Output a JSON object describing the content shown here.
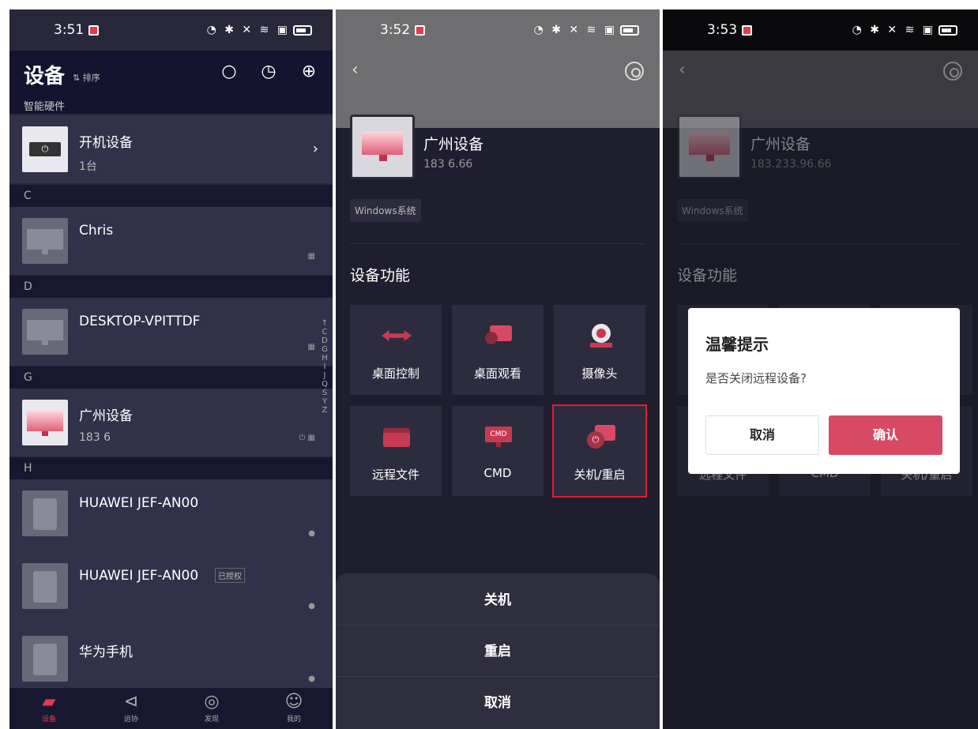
{
  "panel1": {
    "status_time": "3:51",
    "title": "设备",
    "sort_label": "⇅ 排序",
    "section_label": "智能硬件",
    "boot_device": {
      "name": "开机设备",
      "count": "1台"
    },
    "groups": [
      {
        "letter": "C",
        "devices": [
          {
            "name": "Chris",
            "sub": ""
          }
        ]
      },
      {
        "letter": "D",
        "devices": [
          {
            "name": "DESKTOP-VPITTDF",
            "sub": ""
          }
        ]
      },
      {
        "letter": "G",
        "devices": [
          {
            "name": "广州设备",
            "sub": "183 6"
          }
        ]
      },
      {
        "letter": "H",
        "devices": [
          {
            "name": "HUAWEI JEF-AN00",
            "sub": ""
          },
          {
            "name": "HUAWEI JEF-AN00",
            "sub": "",
            "badge": "已授权"
          },
          {
            "name": "华为手机",
            "sub": ""
          }
        ]
      }
    ],
    "alphabet": [
      "↑",
      "C",
      "D",
      "G",
      "H",
      "I",
      "J",
      "Q",
      "S",
      "Y",
      "Z"
    ],
    "tabs": [
      {
        "label": "设备",
        "icon": "devices-icon",
        "active": true
      },
      {
        "label": "远协",
        "icon": "send-icon",
        "active": false
      },
      {
        "label": "发现",
        "icon": "compass-icon",
        "active": false
      },
      {
        "label": "我的",
        "icon": "profile-icon",
        "active": false
      }
    ]
  },
  "panel2": {
    "status_time": "3:52",
    "device_name": "广州设备",
    "device_ip": "183 6.66",
    "os_tag": "Windows系统",
    "section_title": "设备功能",
    "functions": [
      "桌面控制",
      "桌面观看",
      "摄像头",
      "远程文件",
      "CMD",
      "关机/重启"
    ],
    "sheet_options": [
      "关机",
      "重启",
      "取消"
    ]
  },
  "panel3": {
    "status_time": "3:53",
    "device_name": "广州设备",
    "device_ip": "183.233.96.66",
    "os_tag": "Windows系统",
    "section_title": "设备功能",
    "dialog": {
      "title": "温馨提示",
      "message": "是否关闭远程设备?",
      "cancel": "取消",
      "confirm": "确认"
    },
    "bg_labels": [
      "远程文件",
      "CMD",
      "关机/重启"
    ]
  },
  "colors": {
    "accent": "#e8384f",
    "confirm": "#d84a64",
    "highlight": "#e41b2b"
  }
}
